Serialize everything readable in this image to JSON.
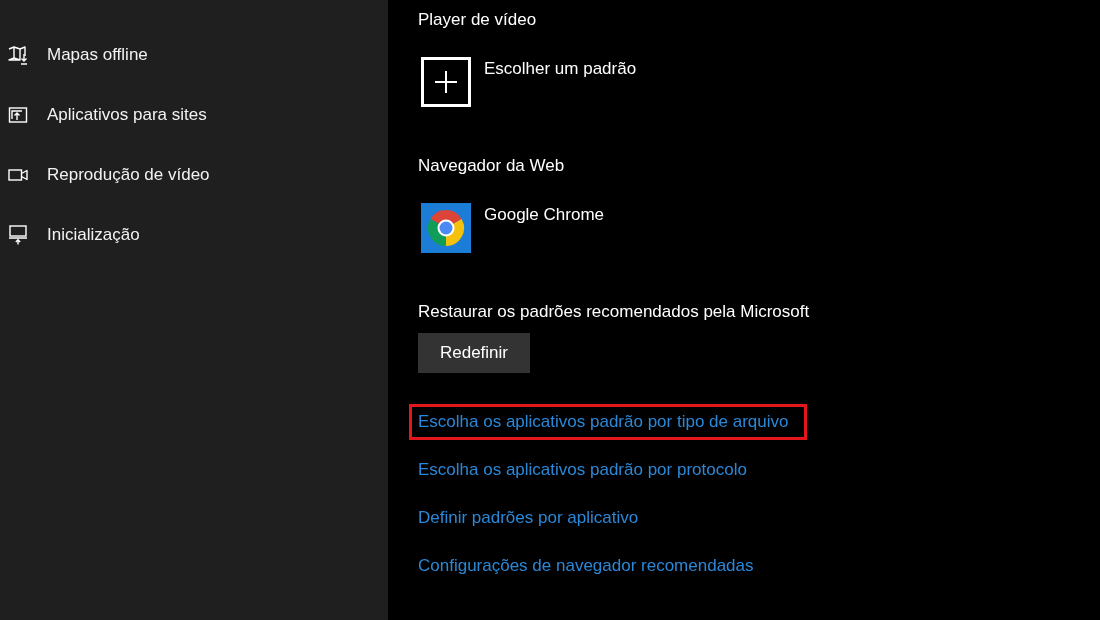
{
  "sidebar": {
    "items": [
      {
        "label": "Mapas offline",
        "selected": false
      },
      {
        "label": "Aplicativos para sites",
        "selected": false
      },
      {
        "label": "Reprodução de vídeo",
        "selected": false
      },
      {
        "label": "Inicialização",
        "selected": false
      }
    ]
  },
  "sections": [
    {
      "heading": "Player de vídeo",
      "app": {
        "kind": "add",
        "label": "Escolher um padrão"
      }
    },
    {
      "heading": "Navegador da Web",
      "app": {
        "kind": "app",
        "label": "Google Chrome"
      }
    }
  ],
  "reset": {
    "label": "Restaurar os padrões recomendados pela Microsoft",
    "button": "Redefinir"
  },
  "links": [
    {
      "label": "Escolha os aplicativos padrão por tipo de arquivo",
      "highlighted": true
    },
    {
      "label": "Escolha os aplicativos padrão por protocolo",
      "highlighted": false
    },
    {
      "label": "Definir padrões por aplicativo",
      "highlighted": false
    },
    {
      "label": "Configurações de navegador recomendadas",
      "highlighted": false
    }
  ]
}
